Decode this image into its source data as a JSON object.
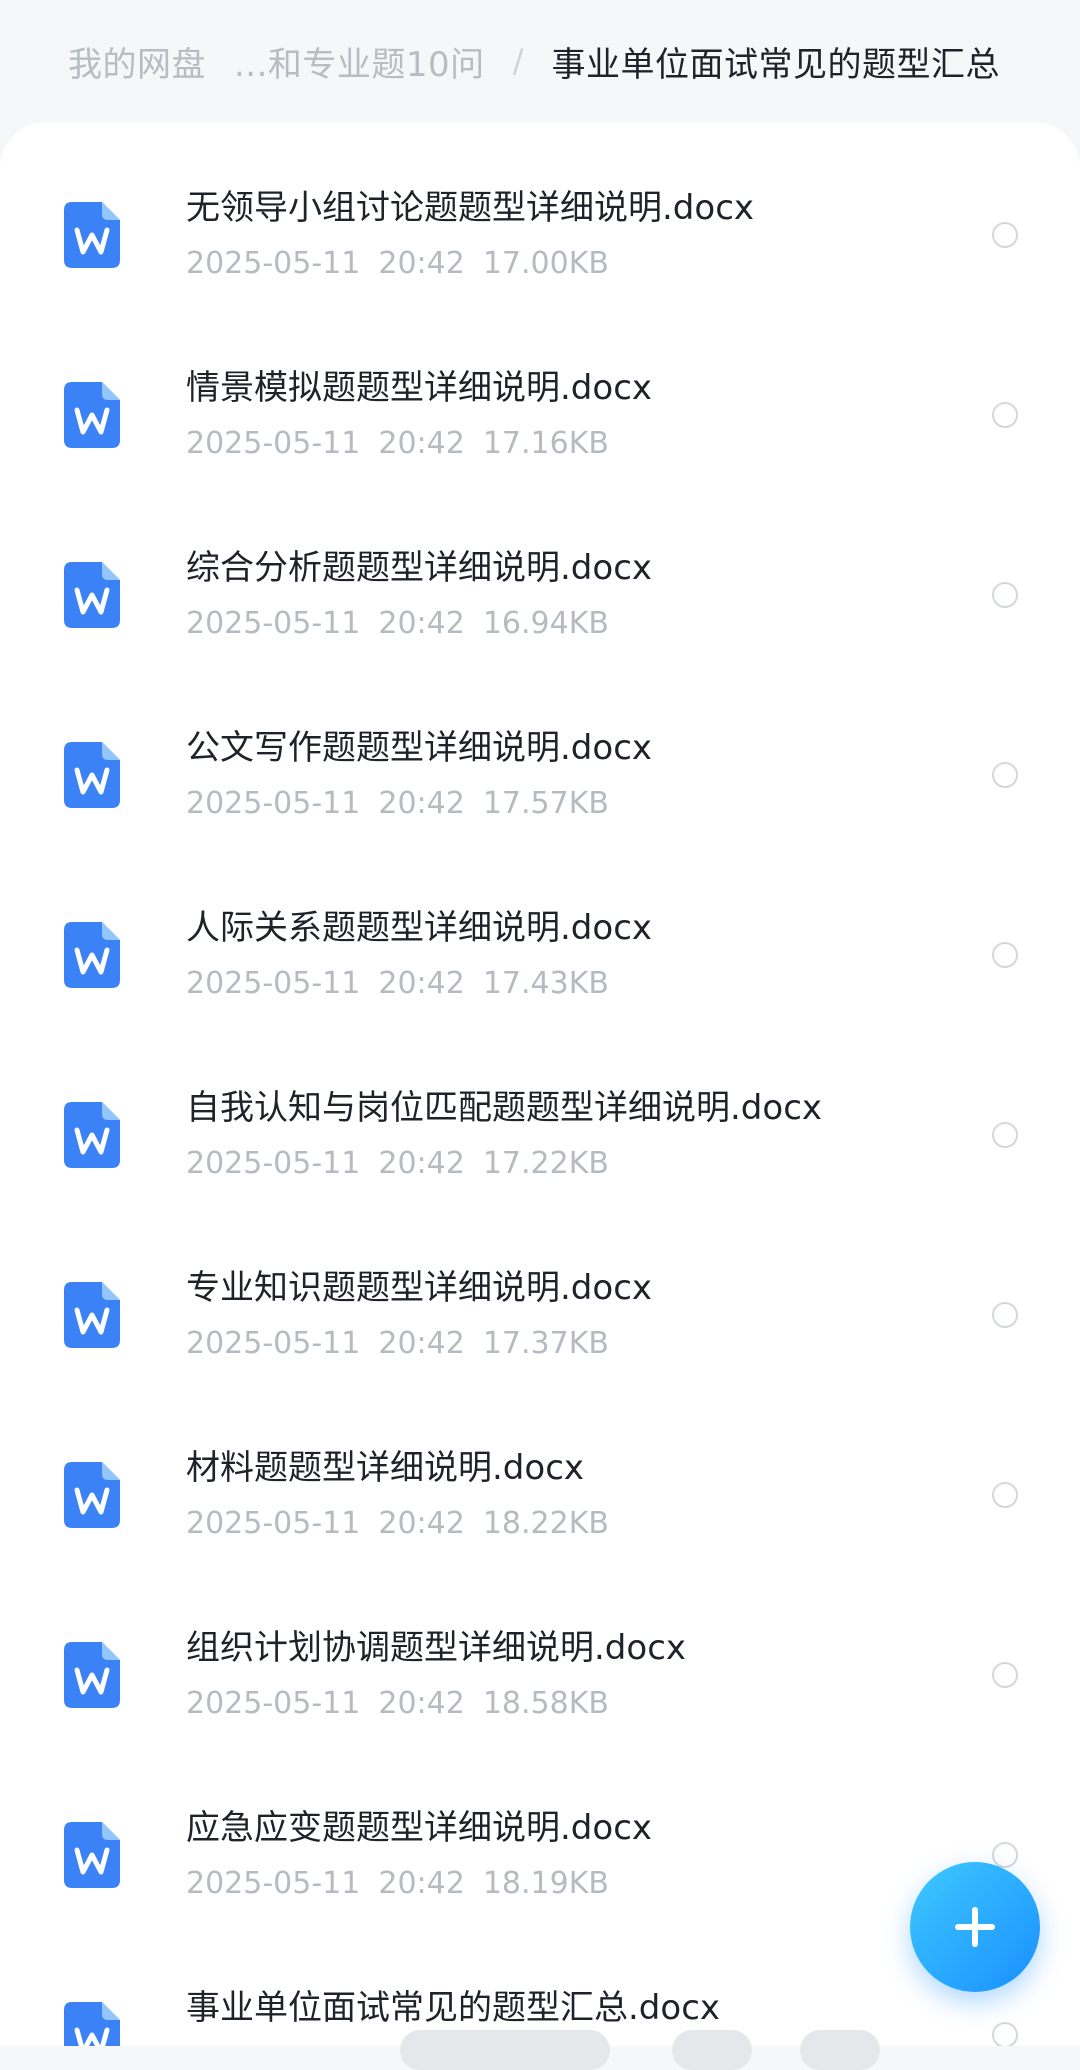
{
  "breadcrumb": {
    "items": [
      "我的网盘",
      "...和专业题10问"
    ],
    "separator": "/",
    "current": "事业单位面试常见的题型汇总"
  },
  "files": [
    {
      "name": "无领导小组讨论题题型详细说明.docx",
      "date": "2025-05-11",
      "time": "20:42",
      "size": "17.00KB",
      "icon": "word-doc-icon"
    },
    {
      "name": "情景模拟题题型详细说明.docx",
      "date": "2025-05-11",
      "time": "20:42",
      "size": "17.16KB",
      "icon": "word-doc-icon"
    },
    {
      "name": "综合分析题题型详细说明.docx",
      "date": "2025-05-11",
      "time": "20:42",
      "size": "16.94KB",
      "icon": "word-doc-icon"
    },
    {
      "name": "公文写作题题型详细说明.docx",
      "date": "2025-05-11",
      "time": "20:42",
      "size": "17.57KB",
      "icon": "word-doc-icon"
    },
    {
      "name": "人际关系题题型详细说明.docx",
      "date": "2025-05-11",
      "time": "20:42",
      "size": "17.43KB",
      "icon": "word-doc-icon"
    },
    {
      "name": "自我认知与岗位匹配题题型详细说明.docx",
      "date": "2025-05-11",
      "time": "20:42",
      "size": "17.22KB",
      "icon": "word-doc-icon"
    },
    {
      "name": "专业知识题题型详细说明.docx",
      "date": "2025-05-11",
      "time": "20:42",
      "size": "17.37KB",
      "icon": "word-doc-icon"
    },
    {
      "name": "材料题题型详细说明.docx",
      "date": "2025-05-11",
      "time": "20:42",
      "size": "18.22KB",
      "icon": "word-doc-icon"
    },
    {
      "name": "组织计划协调题型详细说明.docx",
      "date": "2025-05-11",
      "time": "20:42",
      "size": "18.58KB",
      "icon": "word-doc-icon"
    },
    {
      "name": "应急应变题题型详细说明.docx",
      "date": "2025-05-11",
      "time": "20:42",
      "size": "18.19KB",
      "icon": "word-doc-icon"
    },
    {
      "name": "事业单位面试常见的题型汇总.docx",
      "date": "",
      "time": "",
      "size": "",
      "icon": "word-doc-icon"
    }
  ],
  "fab": {
    "icon": "plus-icon"
  },
  "colors": {
    "accent": "#1a8fff",
    "icon_blue": "#3b82f6",
    "meta_gray": "#b6bac1"
  }
}
